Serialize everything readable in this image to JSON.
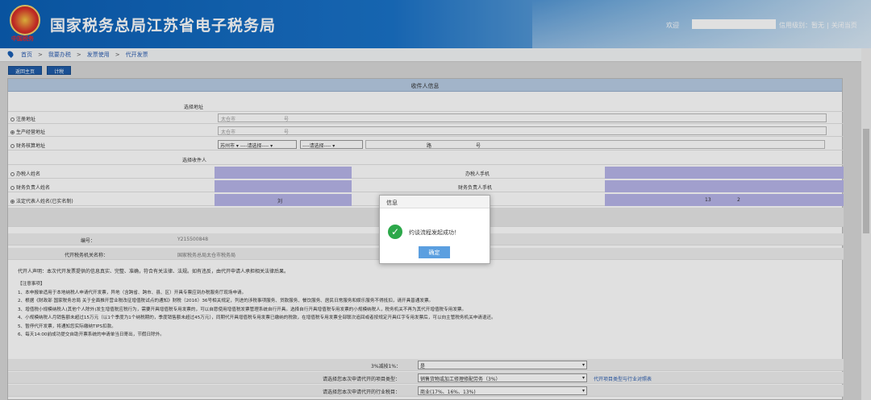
{
  "header": {
    "title": "国家税务总局江苏省电子税务局",
    "emblem_text": "中国税务",
    "welcome": "欢迎",
    "user_level": "信用级别：暂无",
    "logout": "关闭当页"
  },
  "breadcrumb": [
    "首页",
    "我要办税",
    "发票使用",
    "代开发票"
  ],
  "toolbar": {
    "back": "返回主页",
    "calc": "计税"
  },
  "section": {
    "title": "收件人信息"
  },
  "address": {
    "label": "选择地址",
    "registered": "注册地址",
    "production": "生产经营地址",
    "finance": "财务核算地址",
    "val_city": "太仓市",
    "val_num": "号",
    "sel_city": "苏州市",
    "sel_please": "----请选择----",
    "road": "路",
    "hao": "号"
  },
  "recipient": {
    "label": "选择收件人",
    "op_name": "办税人姓名",
    "op_phone": "办税人手机",
    "fin_name": "财务负责人姓名",
    "fin_phone": "财务负责人手机",
    "legal_name": "法定代表人姓名(已实名制)",
    "legal_val": "刘",
    "legal_phone_val_a": "13",
    "legal_phone_val_b": "2"
  },
  "form": {
    "code_label": "编号：",
    "code_val": "Y215500848",
    "agency_label": "代开税务机关名称：",
    "agency_val": "国家税务总局太仓市税务局",
    "statement": "代开人声明：本次代开发票提供的信息真实、完整、准确，符合有关法律、法规。如有违反，由代开申请人承担相关法律后果。"
  },
  "notes": [
    "【注意事项】",
    "1、本申报单适用于本地纳税人申请代开发票，异地（含跨省、跨市、县、区）开具专票应到办税服务厅现场申请。",
    "2、根据《财政部 国家税务总局 关于全面推开营业税改征增值税试点的通知》财税（2016）36号相关规定，列进的涉税事项服务、贷款服务、餐饮服务、居民日常服务和娱乐服务不得抵扣，请开具普通发票。",
    "3、增值税小规模纳税人(其他个人除外)发生增值税应税行为，需要开具增值税专用发票的，可以自愿使用增值税发票管理系统自行开具。选择自行开具增值税专用发票的小规模纳税人，税务机关不再为其代开增值税专用发票。",
    "4、小规模纳税人月销售额未超过15万元（以1个季度为1个纳税期的，季度销售额未超过45万元），同期代开具增值税专用发票已缴纳的税款，在增值税专用发票全部联次追回或者按规定开具红字专用发票后，可以向主管税务机关申请退还。",
    "5、暂停代开发票，将通知您实际缴纳TIPS扣款。",
    "6、每天14:00前成功提交自助开票系统的申请单当日寄出，节假日除外。"
  ],
  "bottom": {
    "q1": "3%减按1%：",
    "a1": "是",
    "q2": "请选择您本次申请代开的项目类型：",
    "a2": "销售货物或加工修理修配劳务（3%）",
    "link": "代开项目类型与行业对照表",
    "q3": "请选择您本次申请代开的行业税目：",
    "a3": "商业(17%、16%、13%)"
  },
  "dialog": {
    "title": "信息",
    "message": "约谈流程发起成功！",
    "ok": "确定"
  }
}
